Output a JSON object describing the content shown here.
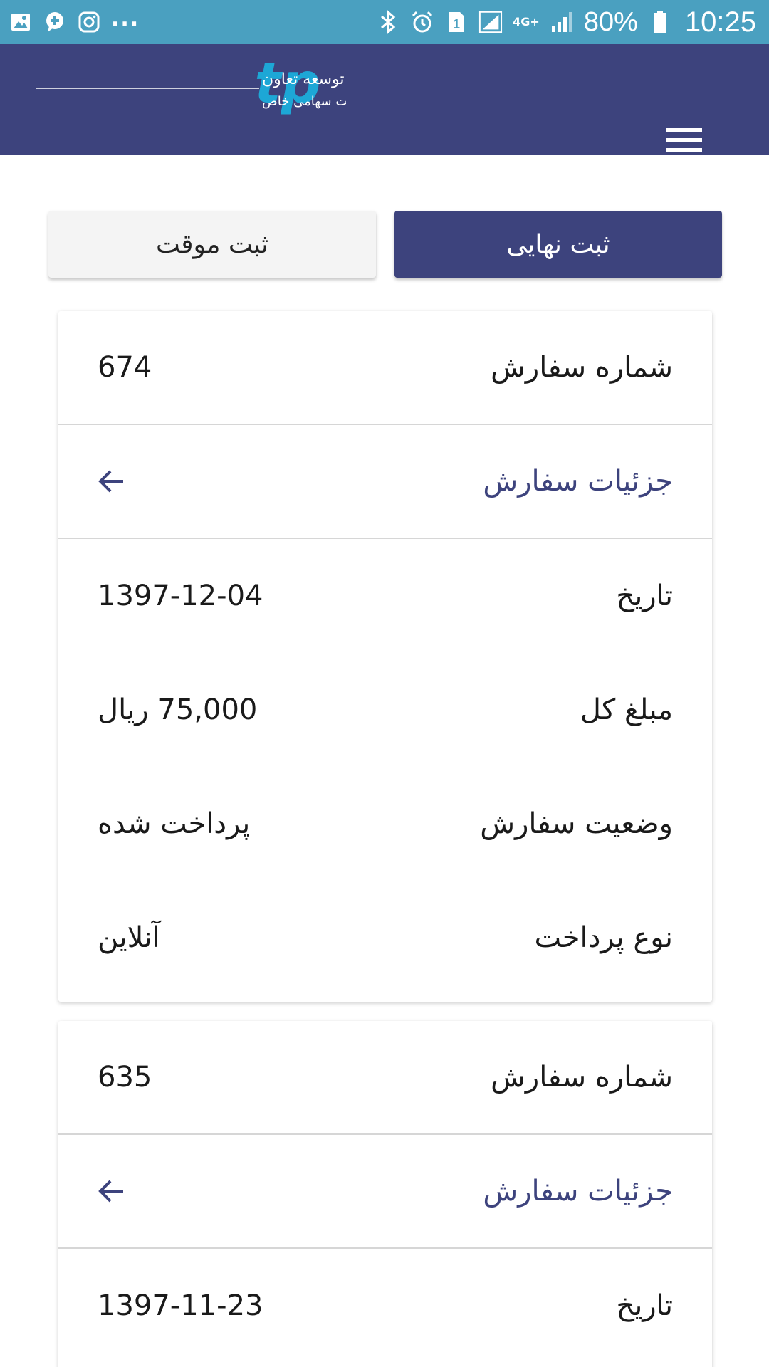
{
  "status_bar": {
    "battery": "80%",
    "time": "10:25",
    "network": "4G+",
    "sim": "1",
    "overflow": "..."
  },
  "app_bar": {
    "logo_letters": "tp",
    "logo_text_main": "مهندسی تامین و پشتیبانی توسعه تعاون",
    "logo_text_sub": "شرکت سهامی خاص"
  },
  "actions": {
    "final_label": "ثبت نهایی",
    "temp_label": "ثبت موقت"
  },
  "labels": {
    "order_number": "شماره سفارش",
    "order_details": "جزئیات سفارش",
    "date": "تاریخ",
    "total": "مبلغ کل",
    "status": "وضعیت سفارش",
    "payment_type": "نوع پرداخت"
  },
  "orders": [
    {
      "number": "674",
      "date": "1397-12-04",
      "total": "75,000 ریال",
      "status": "پرداخت شده",
      "payment_type": "آنلاین"
    },
    {
      "number": "635",
      "date": "1397-11-23"
    }
  ],
  "colors": {
    "status_bar": "#4aa0c0",
    "primary": "#3d437d",
    "logo_accent": "#1da7d6"
  }
}
